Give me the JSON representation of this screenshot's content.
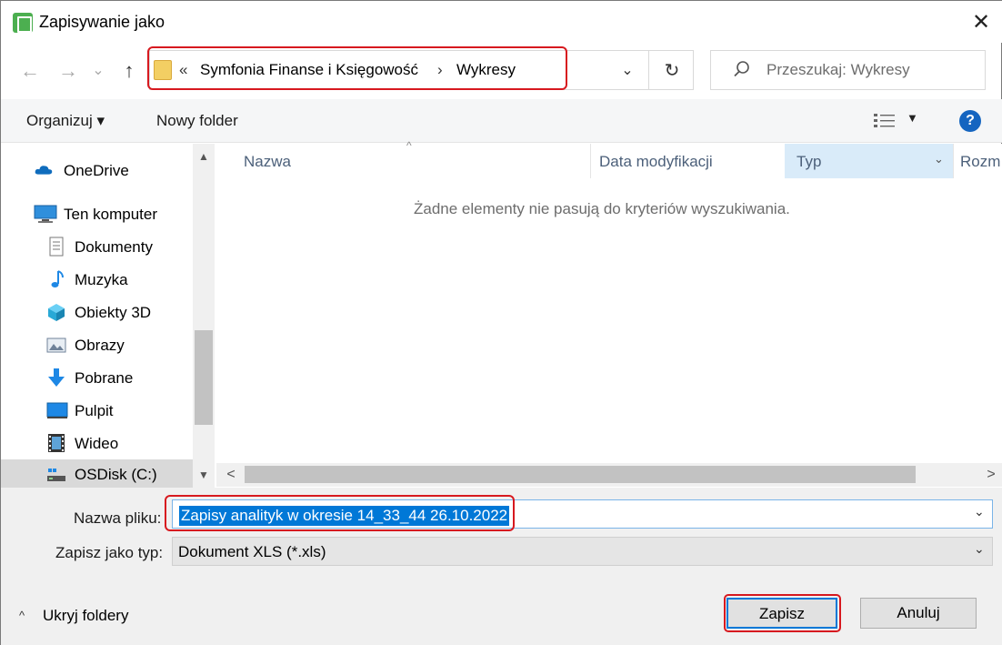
{
  "window": {
    "title": "Zapisywanie jako",
    "close_glyph": "✕"
  },
  "nav": {
    "back_glyph": "←",
    "forward_glyph": "→",
    "recent_glyph": "⌄",
    "up_glyph": "↑",
    "breadcrumb_overflow": "«",
    "breadcrumb": [
      "Symfonia Finanse i Księgowość",
      "Wykresy"
    ],
    "breadcrumb_sep": "›",
    "address_dropdown_glyph": "⌄",
    "refresh_glyph": "↻",
    "search_placeholder": "Przeszukaj: Wykresy"
  },
  "toolbar": {
    "organize_label": "Organizuj ▾",
    "new_folder_label": "Nowy folder",
    "view_dropdown_glyph": "▼",
    "help_glyph": "?"
  },
  "sidebar": {
    "scroll_up_glyph": "▲",
    "scroll_down_glyph": "▼",
    "items": [
      {
        "label": "OneDrive",
        "icon": "onedrive-icon"
      },
      {
        "label": "Ten komputer",
        "icon": "computer-icon"
      },
      {
        "label": "Dokumenty",
        "icon": "documents-icon"
      },
      {
        "label": "Muzyka",
        "icon": "music-icon"
      },
      {
        "label": "Obiekty 3D",
        "icon": "objects-3d-icon"
      },
      {
        "label": "Obrazy",
        "icon": "pictures-icon"
      },
      {
        "label": "Pobrane",
        "icon": "downloads-icon"
      },
      {
        "label": "Pulpit",
        "icon": "desktop-icon"
      },
      {
        "label": "Wideo",
        "icon": "video-icon"
      },
      {
        "label": "OSDisk (C:)",
        "icon": "drive-icon"
      }
    ]
  },
  "file_list": {
    "columns": [
      "Nazwa",
      "Data modyfikacji",
      "Typ",
      "Rozm"
    ],
    "sort_glyph": "^",
    "column_dropdown_glyph": "⌄",
    "empty_message": "Żadne elementy nie pasują do kryteriów wyszukiwania.",
    "scroll_left_glyph": "<",
    "scroll_right_glyph": ">"
  },
  "form": {
    "filename_label": "Nazwa pliku:",
    "filename_value": "Zapisy analityk w okresie 14_33_44 26.10.2022",
    "filetype_label": "Zapisz jako typ:",
    "filetype_value": "Dokument XLS (*.xls)",
    "dropdown_glyph": "⌄"
  },
  "footer": {
    "hide_folders_caret": "^",
    "hide_folders_label": "Ukryj foldery",
    "save_label": "Zapisz",
    "cancel_label": "Anuluj"
  },
  "colors": {
    "accent": "#0078d7",
    "highlight_box": "#d7191f",
    "folder": "#f3cf63"
  }
}
